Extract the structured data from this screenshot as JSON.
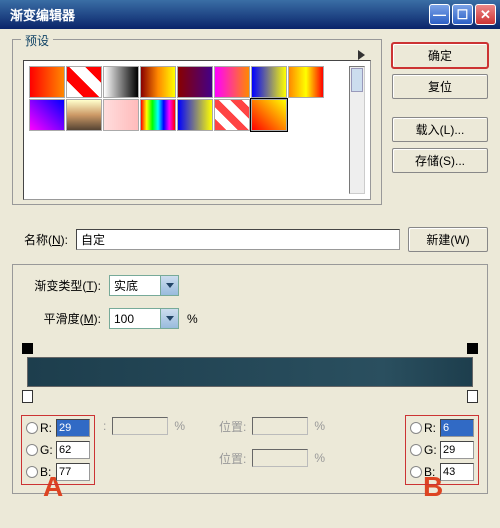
{
  "titlebar": {
    "title": "渐变编辑器"
  },
  "presets": {
    "legend": "预设"
  },
  "buttons": {
    "ok": "确定",
    "reset": "复位",
    "load": "载入(L)...",
    "save": "存储(S)...",
    "new": "新建(W)"
  },
  "name": {
    "label_prefix": "名称(",
    "label_u": "N",
    "label_suffix": "):",
    "value": "自定"
  },
  "gradtype": {
    "label_prefix": "渐变类型(",
    "label_u": "T",
    "label_suffix": "):",
    "value": "实底"
  },
  "smooth": {
    "label_prefix": "平滑度(",
    "label_u": "M",
    "label_suffix": "):",
    "value": "100",
    "pct": "%"
  },
  "annot": {
    "a": "A",
    "b": "B"
  },
  "rgb_left": {
    "r": "29",
    "g": "62",
    "b": "77"
  },
  "rgb_right": {
    "r": "6",
    "g": "29",
    "b": "43"
  },
  "labels": {
    "R": "R:",
    "G": "G:",
    "B": "B:",
    "pos": "位置:",
    "pct": "%"
  },
  "swatches": [
    "linear-gradient(to right,#f00,#f80)",
    "linear-gradient(45deg,#fff 25%,#f00 25%,#f00 50%,#fff 50%,#fff 75%,#f00 75%)",
    "linear-gradient(to right,#fff,#000)",
    "linear-gradient(to right,#800,#f80,#ff0)",
    "linear-gradient(to right,#800,#408)",
    "linear-gradient(to right,#f0f,#f80)",
    "linear-gradient(to right,#00f,#ff0)",
    "linear-gradient(to right,#f80,#ff0,#f00)",
    "linear-gradient(45deg,#f0f,#00f)",
    "linear-gradient(to bottom,#ffc,#c96,#543)",
    "linear-gradient(to right,#fdd,#fbb)",
    "linear-gradient(to right,#f00,#ff0,#0f0,#0ff,#00f,#f0f,#f00)",
    "linear-gradient(to right,#00f,#ff0)",
    "repeating-linear-gradient(45deg,#f44 0 8px,#fff 8px 16px)",
    "linear-gradient(45deg,#f00,#ff0)"
  ]
}
